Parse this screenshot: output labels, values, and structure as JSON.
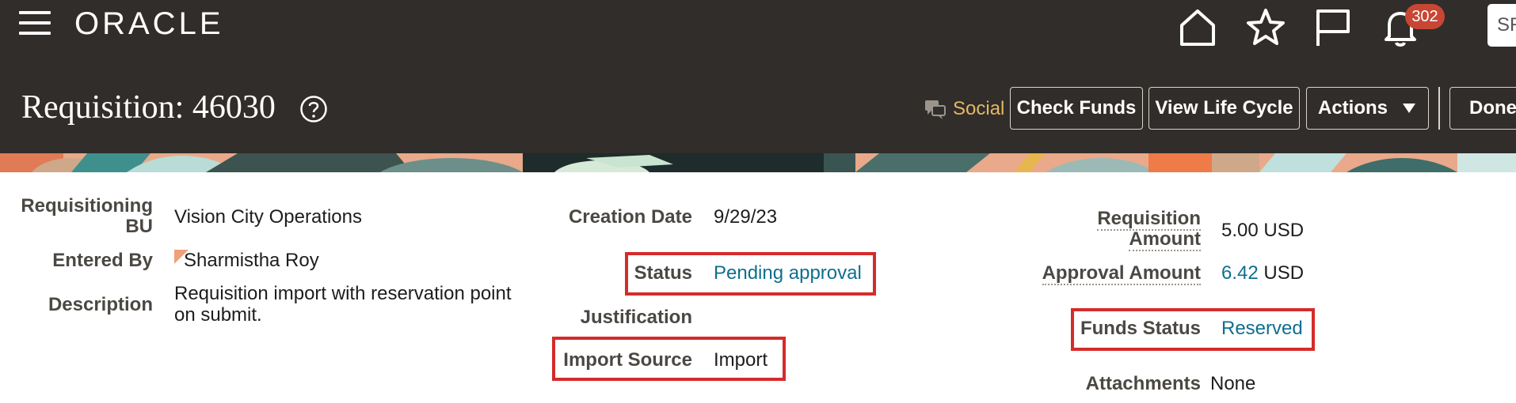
{
  "app": {
    "brand": "ORACLE"
  },
  "header_icons": {
    "notifications_count": "302",
    "user_initials": "SR"
  },
  "page": {
    "title": "Requisition: 46030"
  },
  "actions": {
    "social": "Social",
    "check_funds": "Check Funds",
    "view_life_cycle": "View Life Cycle",
    "actions": "Actions",
    "done": "Done"
  },
  "fields": {
    "requisitioning_bu_label_1": "Requisitioning",
    "requisitioning_bu_label_2": "BU",
    "requisitioning_bu": "Vision City Operations",
    "entered_by_label": "Entered By",
    "entered_by": "Sharmistha Roy",
    "description_label": "Description",
    "description_line1": "Requisition import with reservation point",
    "description_line2": "on submit.",
    "creation_date_label": "Creation Date",
    "creation_date": "9/29/23",
    "status_label": "Status",
    "status": "Pending approval",
    "justification_label": "Justification",
    "import_source_label": "Import Source",
    "import_source": "Import",
    "requisition_amount_label_1": "Requisition",
    "requisition_amount_label_2": "Amount",
    "requisition_amount": "5.00",
    "requisition_amount_currency": "USD",
    "approval_amount_label": "Approval Amount",
    "approval_amount": "6.42",
    "approval_amount_currency": "USD",
    "funds_status_label": "Funds Status",
    "funds_status": "Reserved",
    "attachments_label": "Attachments",
    "attachments": "None"
  },
  "colors": {
    "header_bg": "#312d2a",
    "link": "#0e6f8f",
    "highlight": "#d52b2b",
    "badge": "#c74634",
    "social": "#e4b864"
  }
}
